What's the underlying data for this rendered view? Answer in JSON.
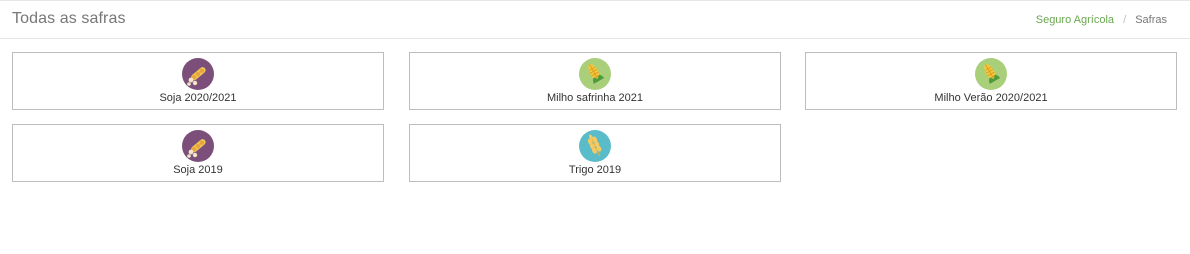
{
  "header": {
    "title": "Todas as safras",
    "breadcrumb": {
      "link": "Seguro Agrícola",
      "separator": "/",
      "current": "Safras"
    }
  },
  "cards": [
    {
      "label": "Soja 2020/2021",
      "icon": "soy-icon",
      "icon_bg": "#7b4f7a"
    },
    {
      "label": "Milho safrinha 2021",
      "icon": "corn-icon",
      "icon_bg": "#a9cf7a"
    },
    {
      "label": "Milho Verão 2020/2021",
      "icon": "corn-icon",
      "icon_bg": "#a9cf7a"
    },
    {
      "label": "Soja 2019",
      "icon": "soy-icon",
      "icon_bg": "#7b4f7a"
    },
    {
      "label": "Trigo 2019",
      "icon": "wheat-icon",
      "icon_bg": "#5bbcc9"
    }
  ],
  "colors": {
    "accent_link": "#6aa84f",
    "soy": "#7b4f7a",
    "corn": "#a9cf7a",
    "wheat": "#5bbcc9"
  }
}
